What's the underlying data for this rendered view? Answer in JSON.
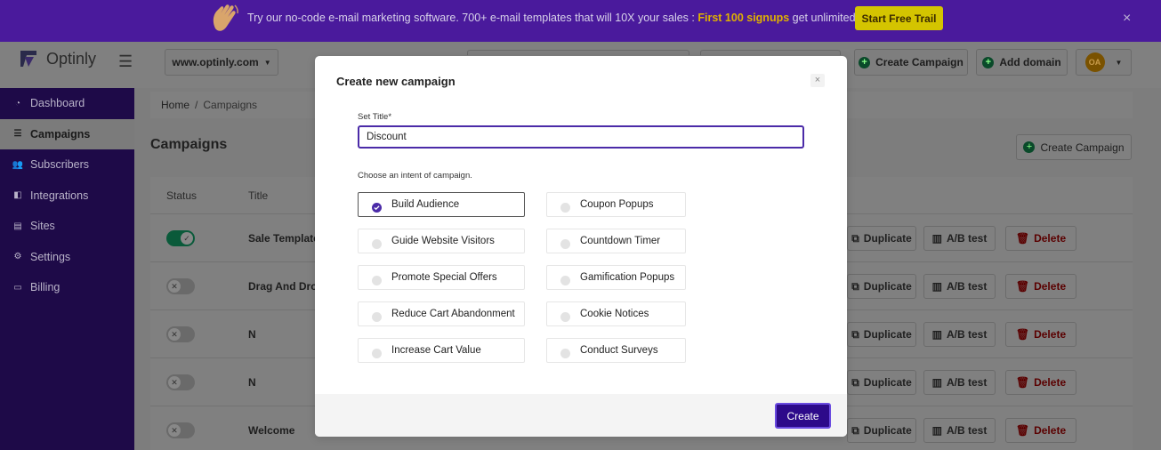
{
  "banner": {
    "text_before": "Try our no-code e-mail marketing software. 700+ e-mail templates that will 10X your sales :",
    "highlight": "First 100 signups",
    "text_after": "get unlimited contacts",
    "cta": "Start Free Trail",
    "close": "×"
  },
  "header": {
    "app_name": "Optinly",
    "domain_select": "www.optinly.com",
    "create_campaign": "Create Campaign",
    "add_domain": "Add domain",
    "avatar_initials": "OA"
  },
  "sidebar": {
    "items": [
      {
        "label": "Dashboard",
        "icon": "dashboard-icon"
      },
      {
        "label": "Campaigns",
        "icon": "list-icon"
      },
      {
        "label": "Subscribers",
        "icon": "users-icon"
      },
      {
        "label": "Integrations",
        "icon": "integrations-icon"
      },
      {
        "label": "Sites",
        "icon": "sites-icon"
      },
      {
        "label": "Settings",
        "icon": "gear-icon"
      },
      {
        "label": "Billing",
        "icon": "billing-icon"
      }
    ]
  },
  "main": {
    "breadcrumb_home": "Home",
    "breadcrumb_sep": "/",
    "breadcrumb_current": "Campaigns",
    "title": "Campaigns",
    "create_campaign": "Create Campaign",
    "columns": {
      "status": "Status",
      "title": "Title"
    },
    "rows": [
      {
        "title": "Sale Template -",
        "on": true
      },
      {
        "title": "Drag And Drop",
        "on": false
      },
      {
        "title": "N",
        "on": false
      },
      {
        "title": "N",
        "on": false
      },
      {
        "title": "Welcome",
        "on": false
      }
    ],
    "row_actions": {
      "duplicate": "Duplicate",
      "ab_test": "A/B test",
      "delete": "Delete"
    }
  },
  "modal": {
    "title": "Create new campaign",
    "close": "×",
    "title_label": "Set Title*",
    "title_value": "Discount",
    "intent_label": "Choose an intent of campaign.",
    "intents_left": [
      "Build Audience",
      "Guide Website Visitors",
      "Promote Special Offers",
      "Reduce Cart Abandonment",
      "Increase Cart Value"
    ],
    "intents_right": [
      "Coupon Popups",
      "Countdown Timer",
      "Gamification Popups",
      "Cookie Notices",
      "Conduct Surveys"
    ],
    "selected_intent": "Build Audience",
    "create_button": "Create"
  }
}
